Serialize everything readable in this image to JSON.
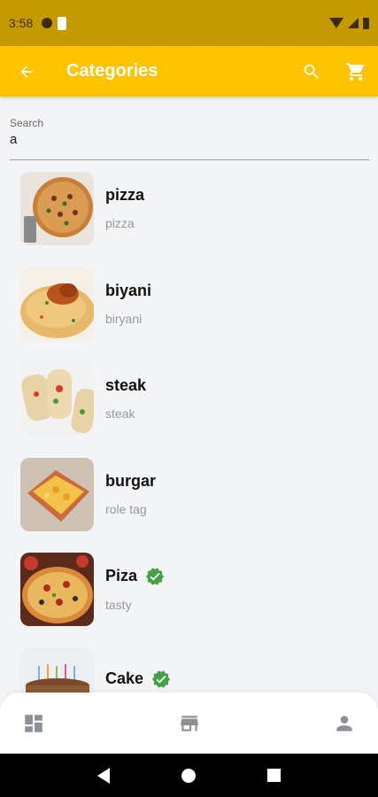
{
  "status_bar": {
    "time": "3:58"
  },
  "app_bar": {
    "title": "Categories"
  },
  "search": {
    "label": "Search",
    "value": "a"
  },
  "categories": [
    {
      "title": "pizza",
      "subtitle": "pizza",
      "verified": false,
      "thumb": "pizza"
    },
    {
      "title": "biyani",
      "subtitle": "biryani",
      "verified": false,
      "thumb": "biryani"
    },
    {
      "title": "steak",
      "subtitle": "steak",
      "verified": false,
      "thumb": "wrap"
    },
    {
      "title": "burgar",
      "subtitle": "role tag",
      "verified": false,
      "thumb": "burger"
    },
    {
      "title": "Piza",
      "subtitle": "tasty",
      "verified": true,
      "thumb": "pizza2"
    },
    {
      "title": "Cake",
      "subtitle": "",
      "verified": true,
      "thumb": "cake"
    }
  ],
  "colors": {
    "app_bar": "#ffc400",
    "status_bar": "#c49a00",
    "verified": "#43a047",
    "background": "#f3f4f6"
  },
  "icons": [
    "back-arrow-icon",
    "search-icon",
    "cart-icon",
    "dashboard-icon",
    "store-icon",
    "person-icon",
    "verified-icon"
  ]
}
